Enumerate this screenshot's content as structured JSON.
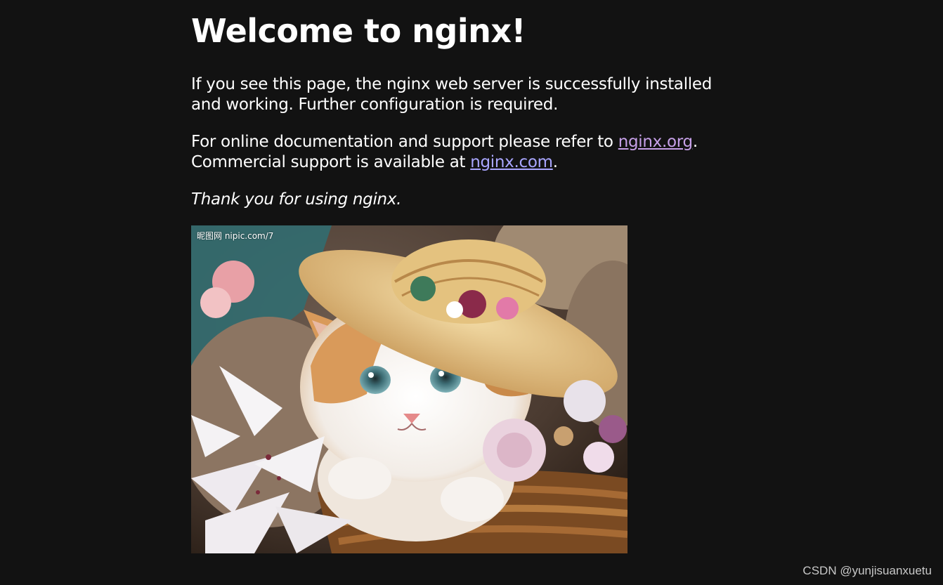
{
  "heading": "Welcome to nginx!",
  "paragraph1": "If you see this page, the nginx web server is successfully installed and working. Further configuration is required.",
  "paragraph2": {
    "text_before_link1": "For online documentation and support please refer to ",
    "link1": "nginx.org",
    "text_after_link1": ".",
    "text_before_link2": "Commercial support is available at ",
    "link2": "nginx.com",
    "text_after_link2": "."
  },
  "paragraph3": "Thank you for using nginx.",
  "image": {
    "watermark": "昵图网 nipic.com/7"
  },
  "credit": "CSDN @yunjisuanxuetu",
  "colors": {
    "background": "#121212",
    "text": "#ffffff",
    "link": "#a9a6ff",
    "link_visited": "#c6a0e8"
  }
}
